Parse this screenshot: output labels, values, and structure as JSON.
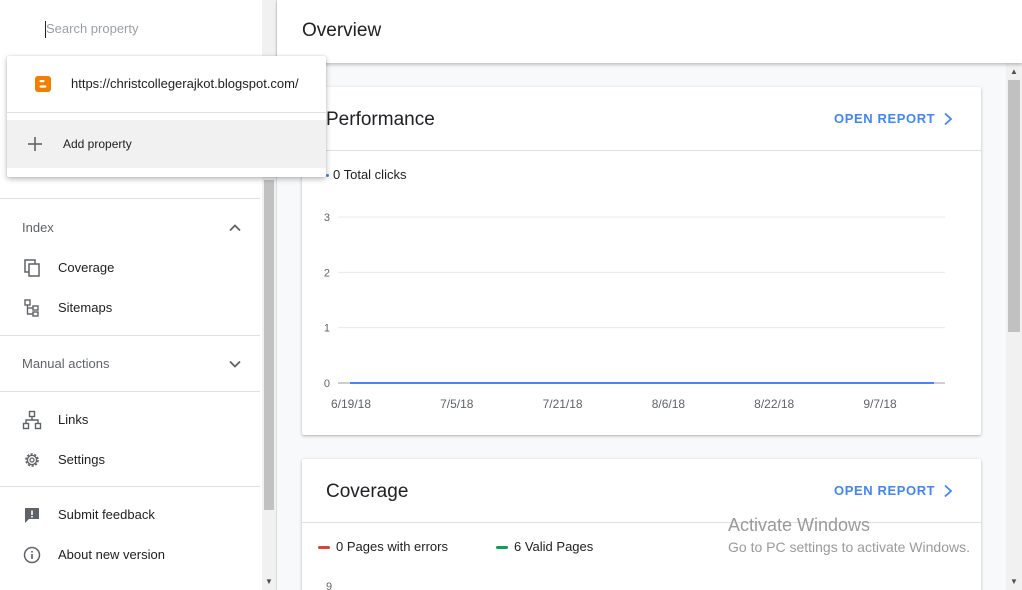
{
  "search": {
    "placeholder": "Search property"
  },
  "property_menu": {
    "property_url": "https://christcollegerajkot.blogspot.com/",
    "add_label": "Add property"
  },
  "sidebar": {
    "index_header": "Index",
    "coverage_label": "Coverage",
    "sitemaps_label": "Sitemaps",
    "manual_actions_header": "Manual actions",
    "links_label": "Links",
    "settings_label": "Settings",
    "feedback_label": "Submit feedback",
    "about_label": "About new version"
  },
  "header": {
    "title": "Overview"
  },
  "performance": {
    "title": "Performance",
    "action": "OPEN REPORT",
    "legend": "0 Total clicks"
  },
  "coverage_card": {
    "title": "Coverage",
    "action": "OPEN REPORT",
    "legend_errors": "0 Pages with errors",
    "legend_valid": "6 Valid Pages",
    "partial_tick": "9"
  },
  "colors": {
    "accent": "#4285f4",
    "line": "#4285f4",
    "errors": "#db4437",
    "valid": "#0f9d58",
    "blogger": "#f57d00"
  },
  "watermark": {
    "title": "Activate Windows",
    "subtitle": "Go to PC settings to activate Windows."
  },
  "chart_data": {
    "type": "line",
    "title": "",
    "xlabel": "",
    "ylabel": "",
    "x_ticks": [
      "6/19/18",
      "7/5/18",
      "7/21/18",
      "8/6/18",
      "8/22/18",
      "9/7/18"
    ],
    "y_ticks": [
      0,
      1,
      2,
      3
    ],
    "ylim": [
      0,
      3
    ],
    "grid": true,
    "series": [
      {
        "name": "Total clicks",
        "color": "#4285f4",
        "values": [
          0,
          0,
          0,
          0,
          0,
          0
        ]
      }
    ]
  }
}
